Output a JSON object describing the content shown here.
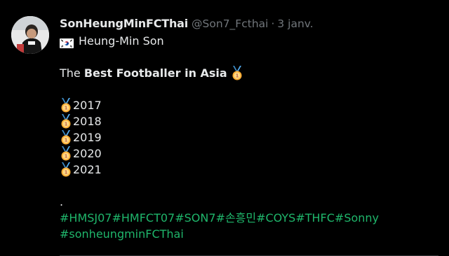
{
  "tweet": {
    "display_name": "SonHeungMinFCThai",
    "handle": "@Son7_Fcthai",
    "separator": "·",
    "time": "3 janv.",
    "name_line": "Heung-Min Son",
    "title_prefix": "The ",
    "title_bold": "Best Footballer in Asia",
    "years": [
      "2017",
      "2018",
      "2019",
      "2020",
      "2021"
    ],
    "dot_line": ".",
    "hashtags_line1": "#HMSJ07#HMFCT07#SON7#손흥민#COYS#THFC#Sonny",
    "hashtags_line2": "#sonheungminFCThai"
  },
  "icons": {
    "flag": "south-korea-flag-icon",
    "medal": "gold-medal-icon"
  },
  "colors": {
    "background": "#000000",
    "text": "#e7e9ea",
    "muted": "#71767b",
    "hashtag": "#1fb66b"
  }
}
